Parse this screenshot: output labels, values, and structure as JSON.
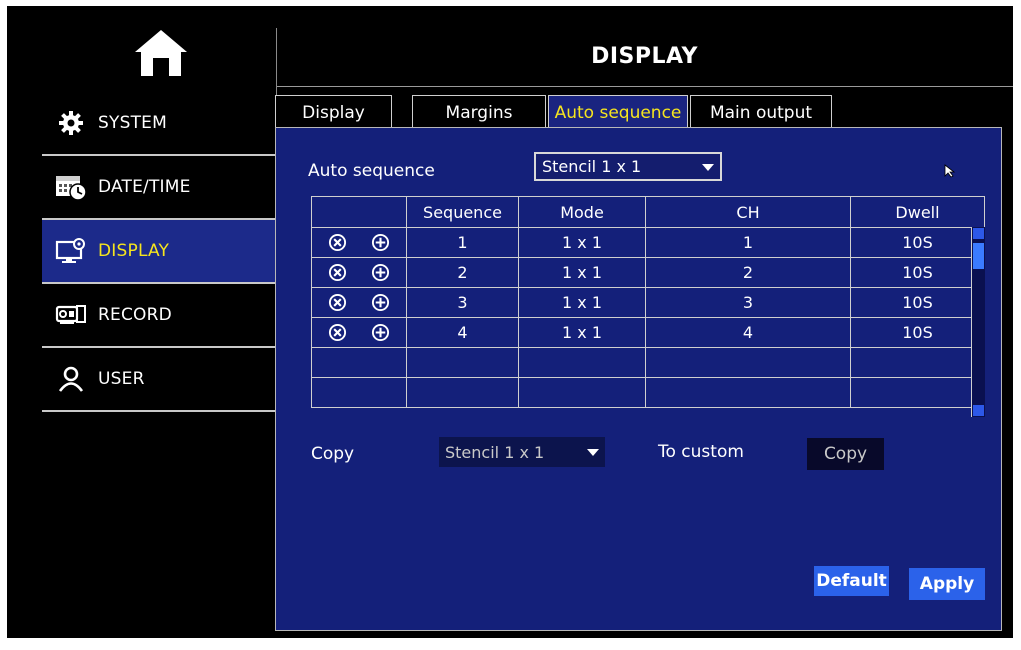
{
  "header": {
    "title": "DISPLAY"
  },
  "sidebar": {
    "home_icon": "home-icon",
    "items": [
      {
        "label": "SYSTEM",
        "icon": "gear-icon"
      },
      {
        "label": "DATE/TIME",
        "icon": "calendar-clock-icon"
      },
      {
        "label": "DISPLAY",
        "icon": "monitor-gear-icon",
        "active": true
      },
      {
        "label": "RECORD",
        "icon": "camera-icon"
      },
      {
        "label": "USER",
        "icon": "user-icon"
      }
    ]
  },
  "tabs": [
    {
      "label": "Display"
    },
    {
      "label": "Margins"
    },
    {
      "label": "Auto sequence",
      "active": true
    },
    {
      "label": "Main output"
    }
  ],
  "auto_sequence": {
    "label": "Auto sequence",
    "value": "Stencil 1 x 1"
  },
  "table": {
    "headers": [
      "",
      "Sequence",
      "Mode",
      "CH",
      "Dwell"
    ],
    "rows": [
      {
        "sequence": "1",
        "mode": "1 x 1",
        "ch": "1",
        "dwell": "10S"
      },
      {
        "sequence": "2",
        "mode": "1 x 1",
        "ch": "2",
        "dwell": "10S"
      },
      {
        "sequence": "3",
        "mode": "1 x 1",
        "ch": "3",
        "dwell": "10S"
      },
      {
        "sequence": "4",
        "mode": "1 x 1",
        "ch": "4",
        "dwell": "10S"
      }
    ],
    "row_icons": [
      "delete-circle-icon",
      "add-circle-icon"
    ]
  },
  "copy_row": {
    "copy_label": "Copy",
    "source_value": "Stencil 1 x 1",
    "to_label": "To custom",
    "copy_button": "Copy"
  },
  "buttons": {
    "default": "Default",
    "apply": "Apply"
  },
  "colors": {
    "panel_bg": "#14207a",
    "active_nav_bg": "#1c2a8a",
    "active_text": "#f6e51e",
    "button_blue": "#2b62ea"
  }
}
